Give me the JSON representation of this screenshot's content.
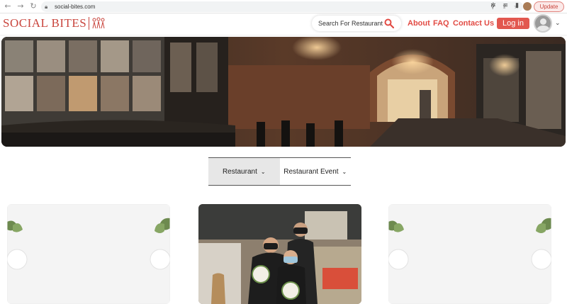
{
  "browser": {
    "url": "social-bites.com",
    "update_label": "Update"
  },
  "header": {
    "logo_text": "SOCIAL BITES",
    "search_placeholder": "Search For Restaurant",
    "nav": {
      "about": "About",
      "faq": "FAQ",
      "contact": "Contact Us"
    },
    "login_label": "Log in"
  },
  "tabs": [
    {
      "label": "Restaurant",
      "selected": true
    },
    {
      "label": "Restaurant Event",
      "selected": false
    }
  ],
  "colors": {
    "brand": "#e24b44",
    "tab_active": "#e7e7e7"
  }
}
